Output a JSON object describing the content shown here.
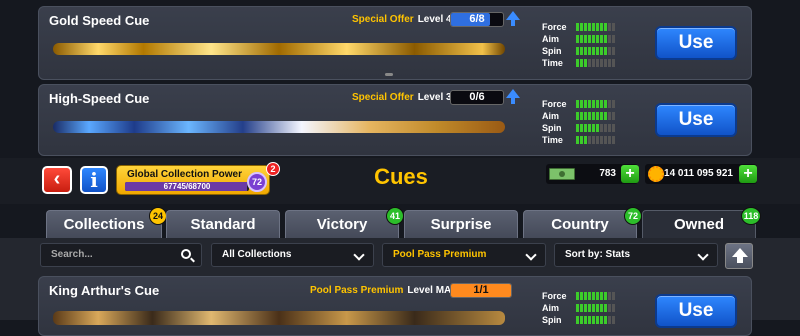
{
  "cards": [
    {
      "name": "Gold Speed Cue",
      "offer": "Special Offer",
      "level": "Level 4",
      "progress": "6/8",
      "progress_fraction": 0.75,
      "use": "Use",
      "stats": {
        "force": "Force",
        "aim": "Aim",
        "spin": "Spin",
        "time": "Time"
      },
      "force": 8,
      "aim": 8,
      "spin": 8,
      "time": 3
    },
    {
      "name": "High-Speed Cue",
      "offer": "Special Offer",
      "level": "Level 3",
      "progress": "0/6",
      "progress_fraction": 0,
      "use": "Use",
      "stats": {
        "force": "Force",
        "aim": "Aim",
        "spin": "Spin",
        "time": "Time"
      },
      "force": 8,
      "aim": 8,
      "spin": 6,
      "time": 3
    }
  ],
  "header": {
    "title": "Cues",
    "gcp_label": "Global Collection Power",
    "gcp_value": "67745/68700",
    "gcp_fraction": 0.986,
    "gcp_level": "72",
    "notif": "2",
    "cash": "783",
    "coins": "14 011 095 921"
  },
  "tabs": [
    {
      "label": "Collections",
      "badge": "24"
    },
    {
      "label": "Standard",
      "badge": ""
    },
    {
      "label": "Victory",
      "badge": "41"
    },
    {
      "label": "Surprise",
      "badge": ""
    },
    {
      "label": "Country",
      "badge": "72"
    },
    {
      "label": "Owned",
      "badge": "118"
    }
  ],
  "filters": {
    "search_placeholder": "Search...",
    "collections": "All Collections",
    "pass": "Pool Pass Premium",
    "sort": "Sort by: Stats"
  },
  "bottom_card": {
    "name": "King Arthur's Cue",
    "offer": "Pool Pass Premium",
    "level": "Level MAX",
    "progress": "1/1",
    "use": "Use",
    "stats": {
      "force": "Force",
      "aim": "Aim",
      "spin": "Spin"
    }
  },
  "colors": {
    "accent": "#ffc400",
    "use_blue": "#1e6ef0",
    "green": "#3ccc2a"
  }
}
